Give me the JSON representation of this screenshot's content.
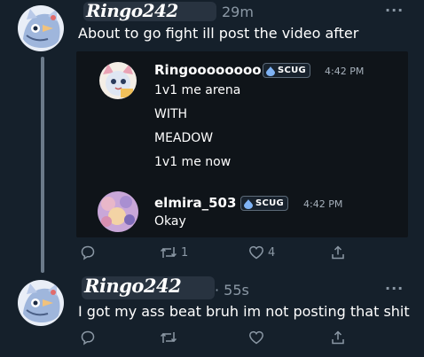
{
  "post1": {
    "username_handwritten": "Ringo242",
    "time": "29m",
    "text": "About to go fight ill post the video after",
    "embed": {
      "messages": [
        {
          "name": "Ringoooooooo",
          "badge": "SCUG",
          "time": "4:42 PM",
          "lines": [
            "1v1 me arena",
            "WITH",
            "MEADOW",
            "1v1 me now"
          ]
        },
        {
          "name": "elmira_503",
          "badge": "SCUG",
          "time": "4:42 PM",
          "lines": [
            "Okay"
          ]
        }
      ]
    },
    "actions": {
      "reply_count": "",
      "repost_count": "1",
      "like_count": "4"
    }
  },
  "post2": {
    "username_handwritten": "Ringo242",
    "time": "· 55s",
    "text": "I got my ass beat bruh im not posting that shit",
    "actions": {
      "reply_count": "",
      "repost_count": "",
      "like_count": ""
    }
  },
  "icons": {
    "more": "more-horizontal-icon",
    "reply": "reply-bubble-icon",
    "repost": "repost-arrows-icon",
    "like": "heart-icon",
    "share": "share-upload-icon",
    "badge": "scug-drop-icon"
  },
  "colors": {
    "background": "#15202b",
    "embed_background": "#0f1419",
    "muted_text": "#8b98a5",
    "badge_accent": "#7fb3f5"
  }
}
